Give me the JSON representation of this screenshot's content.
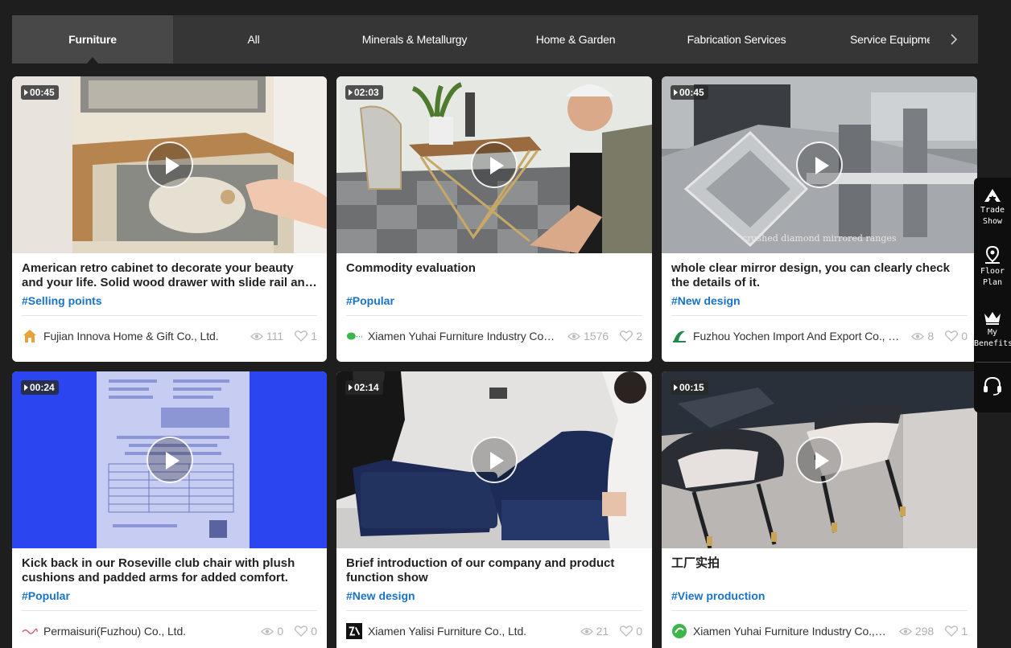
{
  "tabs": [
    {
      "label": "Furniture",
      "active": true
    },
    {
      "label": "All"
    },
    {
      "label": "Minerals & Metallurgy"
    },
    {
      "label": "Home & Garden"
    },
    {
      "label": "Fabrication Services"
    },
    {
      "label": "Service Equipment"
    }
  ],
  "cards": [
    {
      "duration": "00:45",
      "title": "American retro cabinet to decorate your beauty and your life. Solid wood drawer with slide rail and three-drawer",
      "tag": "#Selling points",
      "company": "Fujian Innova Home & Gift Co., Ltd.",
      "views": "111",
      "likes": "1"
    },
    {
      "duration": "02:03",
      "title": "Commodity evaluation",
      "tag": "#Popular",
      "company": "Xiamen Yuhai Furniture Industry Co., Ltd.",
      "views": "1576",
      "likes": "2"
    },
    {
      "duration": "00:45",
      "title": "whole clear mirror design, you can clearly check the details of it.",
      "tag": "#New design",
      "company": "Fuzhou Yochen Import And Export Co., Ltd.",
      "views": "8",
      "likes": "0"
    },
    {
      "duration": "00:24",
      "title": "Kick back in our Roseville club chair with plush cushions and padded arms for added comfort.",
      "tag": "#Popular",
      "company": "Permaisuri(Fuzhou) Co., Ltd.",
      "views": "0",
      "likes": "0"
    },
    {
      "duration": "02:14",
      "title": "Brief introduction of our company and product function show",
      "tag": "#New design",
      "company": "Xiamen Yalisi Furniture Co., Ltd.",
      "views": "21",
      "likes": "0"
    },
    {
      "duration": "00:15",
      "title": "工厂实拍",
      "tag": "#View production",
      "company": "Xiamen Yuhai Furniture Industry Co., Ltd.",
      "views": "298",
      "likes": "1"
    }
  ],
  "thumb_text": {
    "mirror_caption": "crushed diamond mirrored ranges"
  },
  "sidebar": {
    "trade_show": [
      "Trade",
      "Show"
    ],
    "floor_plan": [
      "Floor",
      "Plan"
    ],
    "my_benefits": [
      "My",
      "Benefits"
    ]
  },
  "colors": {
    "background": "#1e1e1e",
    "tabbar": "#363636",
    "tab_active": "#484848",
    "tag": "#1a73c8"
  },
  "icons": {
    "next": "chevron-right-icon",
    "views": "eye-icon",
    "likes": "heart-icon",
    "play": "play-icon",
    "support": "headset-icon"
  }
}
